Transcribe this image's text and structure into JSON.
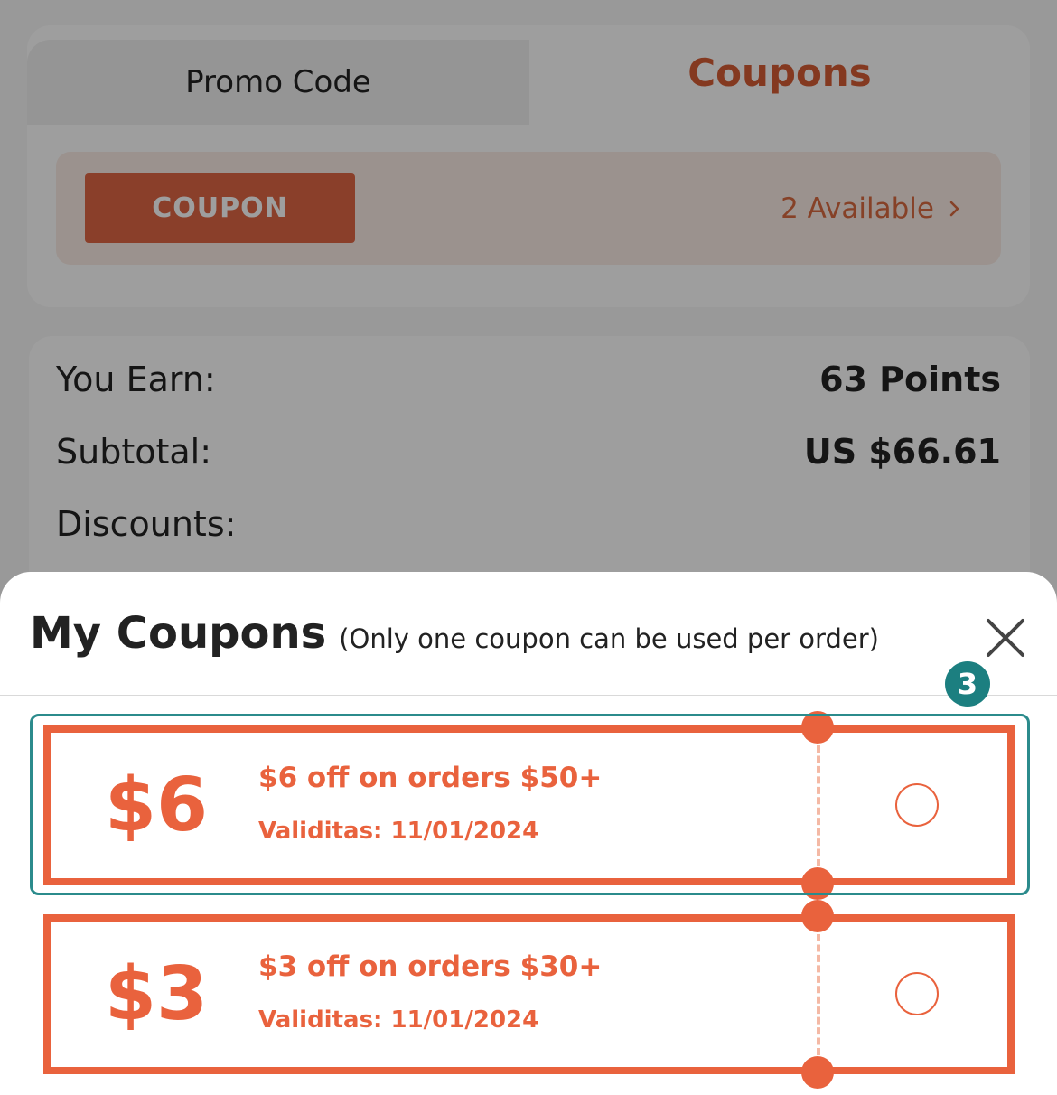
{
  "tabs": {
    "promo_code": "Promo Code",
    "coupons": "Coupons"
  },
  "coupon_bar": {
    "button_label": "COUPON",
    "available": "2 Available"
  },
  "summary": {
    "earn_label": "You Earn:",
    "earn_value": "63 Points",
    "subtotal_label": "Subtotal:",
    "subtotal_value": "US $66.61",
    "discounts_label": "Discounts:"
  },
  "sheet": {
    "title": "My Coupons",
    "subtitle": "(Only one coupon can be used per order)",
    "step_badge": "3"
  },
  "coupons": [
    {
      "amount": "$6",
      "description": "$6 off on orders $50+",
      "validity": "Validitas: 11/01/2024",
      "selected": false
    },
    {
      "amount": "$3",
      "description": "$3 off on orders $30+",
      "validity": "Validitas: 11/01/2024",
      "selected": false
    }
  ],
  "colors": {
    "accent": "#e9623d",
    "tab_active": "#d55c35",
    "badge": "#1c7f80"
  },
  "icons": {
    "close": "close-icon",
    "chevron": "chevron-right-icon"
  }
}
